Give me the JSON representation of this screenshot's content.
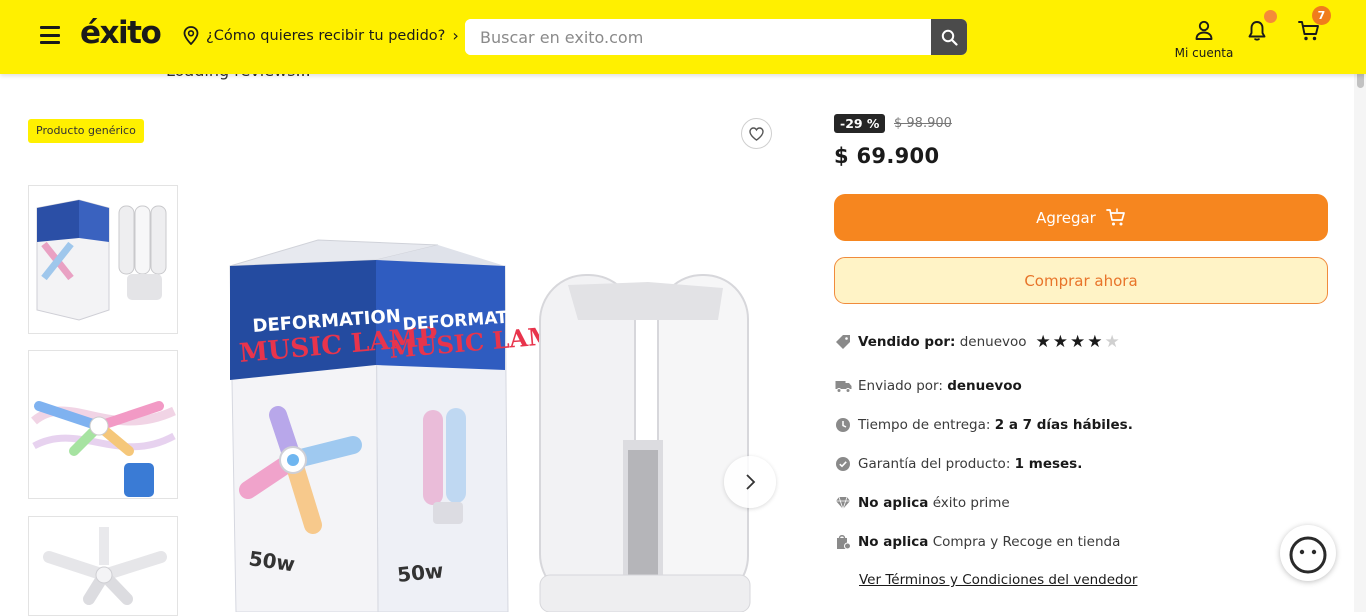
{
  "header": {
    "logo_text": "éxito",
    "location_prompt": "¿Cómo quieres recibir tu pedido?",
    "search_placeholder": "Buscar en exito.com",
    "account_label": "Mi cuenta",
    "cart_count": "7",
    "brand_color": "#fff000"
  },
  "page": {
    "loading_text": "Loading reviews..."
  },
  "product": {
    "generic_badge": "Producto genérico",
    "box_title_line1": "DEFORMATION",
    "box_title_line2": "MUSIC LAMP",
    "box_wattage": "50w",
    "discount": "-29 %",
    "old_price": "$ 98.900",
    "price": "$ 69.900",
    "add_label": "Agregar",
    "buy_now_label": "Comprar ahora",
    "seller_label": "Vendido por:",
    "seller_name": "denuevoo",
    "seller_rating": 4,
    "seller_rating_max": 5,
    "shipped_label": "Enviado por:",
    "shipped_by": "denuevoo",
    "delivery_label": "Tiempo de entrega:",
    "delivery_value": "2 a 7 días hábiles.",
    "warranty_label": "Garantía del producto:",
    "warranty_value": "1 meses.",
    "prime_na": "No aplica",
    "prime_label": "éxito prime",
    "pickup_na": "No aplica",
    "pickup_label": "Compra y Recoge en tienda",
    "terms_link": "Ver Términos y Condiciones del vendedor"
  },
  "colors": {
    "accent_orange": "#f6861f",
    "buy_now_bg": "#fff3c6"
  }
}
